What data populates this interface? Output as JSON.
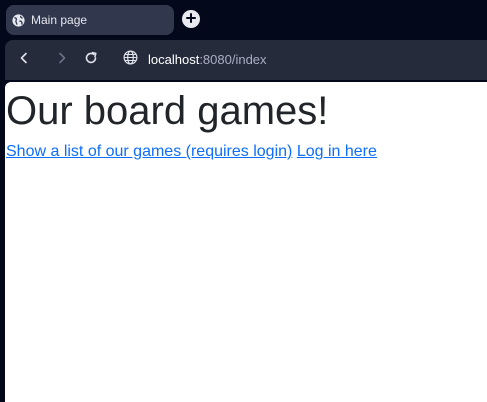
{
  "browser": {
    "tab": {
      "title": "Main page",
      "favicon": "globe-icon"
    },
    "new_tab_icon": "plus-icon",
    "toolbar": {
      "back_icon": "chevron-left-icon",
      "forward_icon": "chevron-right-icon",
      "reload_icon": "reload-icon",
      "site_info_icon": "globe-icon",
      "url_host": "localhost",
      "url_rest": ":8080/index"
    }
  },
  "page": {
    "heading": "Our board games!",
    "links": [
      {
        "label": "Show a list of our games (requires login)"
      },
      {
        "label": "Log in here"
      }
    ]
  },
  "colors": {
    "chrome_background": "#03081a",
    "toolbar": "#262b3c",
    "active_tab": "#31374d",
    "link": "#0d6efd",
    "heading": "#212529"
  }
}
